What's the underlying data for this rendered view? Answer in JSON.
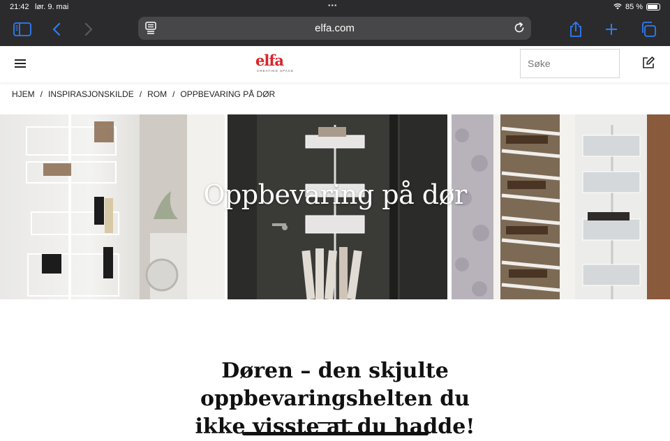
{
  "status_bar": {
    "time": "21:42",
    "date": "lør. 9. mai",
    "battery_percent": "85 %",
    "battery_level": 0.85
  },
  "browser": {
    "url": "elfa.com",
    "icons": [
      "sidebar-icon",
      "back-icon",
      "forward-icon",
      "reader-icon",
      "reload-icon",
      "share-icon",
      "new-tab-icon",
      "tabs-icon"
    ]
  },
  "site": {
    "brand": "elfa",
    "tagline": "CREATING SPACE",
    "search_placeholder": "Søke",
    "brand_color": "#d6262b"
  },
  "breadcrumb": {
    "items": [
      "HJEM",
      "INSPIRASJONSKILDE",
      "ROM",
      "OPPBEVARING PÅ DØR"
    ],
    "separator": "/"
  },
  "hero": {
    "title": "Oppbevaring på dør"
  },
  "article": {
    "heading_line1": "Døren – den skjulte oppbevaringshelten du",
    "heading_line2": "ikke visste at du hadde!"
  }
}
